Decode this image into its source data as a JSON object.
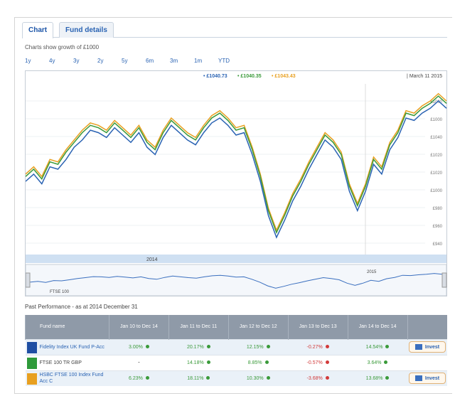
{
  "tabs": [
    {
      "label": "Chart",
      "active": true
    },
    {
      "label": "Fund details",
      "active": false
    }
  ],
  "subtitle": "Charts show growth of £1000",
  "periods": [
    "1y",
    "4y",
    "3y",
    "2y",
    "5y",
    "6m",
    "3m",
    "1m",
    "YTD"
  ],
  "chart": {
    "legend": [
      {
        "label": "£1040.73",
        "color": "#2a63b3"
      },
      {
        "label": "£1040.35",
        "color": "#3a9a3a"
      },
      {
        "label": "£1043.43",
        "color": "#e8a020"
      }
    ],
    "date": "March 11 2015",
    "y_ticks": [
      "£1000",
      "£1000",
      "£1040",
      "£1020",
      "£1020",
      "£1000",
      "£980",
      "£960",
      "£940"
    ],
    "x_label": "2014",
    "nav_labels": [
      "FTSE 100",
      "2015"
    ]
  },
  "chart_data": {
    "type": "line",
    "series": [
      {
        "name": "Fidelity Index UK Fund P-Acc",
        "color": "#2a63b3",
        "values": [
          990,
          996,
          988,
          1002,
          1000,
          1008,
          1018,
          1024,
          1032,
          1030,
          1026,
          1034,
          1028,
          1022,
          1030,
          1018,
          1012,
          1026,
          1036,
          1030,
          1024,
          1020,
          1030,
          1038,
          1042,
          1036,
          1028,
          1030,
          1012,
          990,
          962,
          944,
          958,
          974,
          986,
          1000,
          1012,
          1024,
          1018,
          1008,
          982,
          966,
          982,
          1004,
          996,
          1016,
          1026,
          1042,
          1040,
          1046,
          1050,
          1056,
          1050
        ]
      },
      {
        "name": "FTSE 100 TR GBP",
        "color": "#3a9a3a",
        "values": [
          994,
          1000,
          992,
          1006,
          1004,
          1014,
          1022,
          1030,
          1036,
          1034,
          1030,
          1038,
          1032,
          1026,
          1034,
          1022,
          1016,
          1030,
          1040,
          1034,
          1028,
          1024,
          1034,
          1042,
          1046,
          1040,
          1032,
          1034,
          1016,
          994,
          966,
          948,
          962,
          978,
          990,
          1004,
          1016,
          1028,
          1022,
          1012,
          986,
          970,
          986,
          1008,
          1000,
          1020,
          1030,
          1046,
          1044,
          1050,
          1054,
          1060,
          1054
        ]
      },
      {
        "name": "HSBC FTSE 100 Index Fund Acc C",
        "color": "#e8a020",
        "values": [
          996,
          1002,
          994,
          1008,
          1006,
          1016,
          1024,
          1032,
          1038,
          1036,
          1032,
          1040,
          1034,
          1028,
          1036,
          1024,
          1018,
          1032,
          1042,
          1036,
          1030,
          1026,
          1036,
          1044,
          1048,
          1042,
          1034,
          1036,
          1018,
          996,
          968,
          950,
          964,
          980,
          992,
          1006,
          1018,
          1030,
          1024,
          1014,
          988,
          972,
          988,
          1010,
          1002,
          1022,
          1032,
          1048,
          1046,
          1052,
          1056,
          1062,
          1056
        ]
      }
    ],
    "ylim": [
      930,
      1070
    ]
  },
  "performance": {
    "title": "Past Performance - as at 2014 December 31",
    "headers": [
      "Fund name",
      "Jan 10 to Dec 14",
      "Jan 11 to Dec 11",
      "Jan 12 to Dec 12",
      "Jan 13 to Dec 13",
      "Jan 14 to Dec 14"
    ],
    "rows": [
      {
        "name": "Fidelity Index UK Fund P-Acc",
        "swatch": "#1f4ea3",
        "link": true,
        "values": [
          "3.00%",
          "20.17%",
          "12.15%",
          "-0.27%",
          "14.54%"
        ],
        "signs": [
          "pos",
          "pos",
          "pos",
          "neg",
          "pos"
        ],
        "invest": "Invest"
      },
      {
        "name": "FTSE 100 TR GBP",
        "swatch": "#2e9a3a",
        "link": false,
        "values": [
          "-",
          "14.18%",
          "8.85%",
          "-0.57%",
          "3.64%"
        ],
        "signs": [
          "none",
          "pos",
          "pos",
          "neg",
          "pos"
        ],
        "invest": ""
      },
      {
        "name": "HSBC FTSE 100 Index Fund Acc C",
        "swatch": "#e8a020",
        "link": true,
        "values": [
          "6.23%",
          "18.11%",
          "10.30%",
          "-3.68%",
          "13.68%"
        ],
        "signs": [
          "pos",
          "pos",
          "pos",
          "neg",
          "pos"
        ],
        "invest": "Invest"
      }
    ]
  }
}
